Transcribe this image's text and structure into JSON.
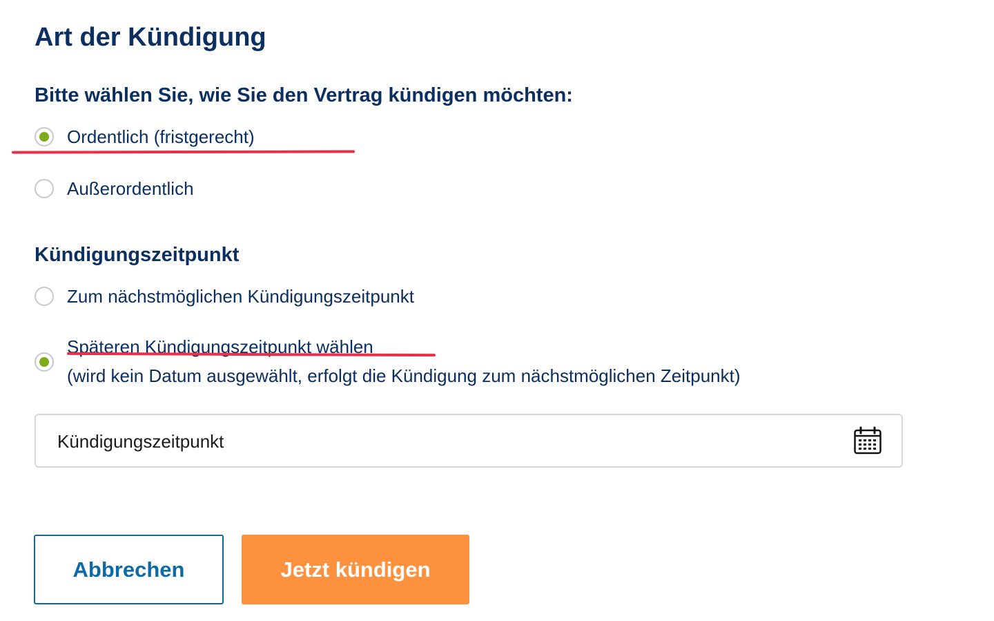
{
  "page": {
    "title": "Art der Kündigung"
  },
  "cancellation_type": {
    "question": "Bitte wählen Sie, wie Sie den Vertrag kündigen möchten:",
    "options": [
      {
        "label": "Ordentlich (fristgerecht)",
        "selected": true
      },
      {
        "label": "Außerordentlich",
        "selected": false
      }
    ]
  },
  "cancellation_date": {
    "heading": "Kündigungszeitpunkt",
    "options": [
      {
        "label": "Zum nächstmöglichen Kündigungszeitpunkt",
        "selected": false
      },
      {
        "label": "Späteren Kündigungszeitpunkt wählen",
        "hint": "(wird kein Datum ausgewählt, erfolgt die Kündigung zum nächstmöglichen Zeitpunkt)",
        "selected": true
      }
    ],
    "date_field": {
      "placeholder": "Kündigungszeitpunkt",
      "icon": "calendar-icon"
    }
  },
  "actions": {
    "cancel_label": "Abbrechen",
    "submit_label": "Jetzt kündigen"
  },
  "colors": {
    "heading": "#0b2f61",
    "radio_selected": "#7fab1a",
    "annotation_underline": "#e8304a",
    "cancel_button": "#0b6aa8",
    "submit_button": "#fd913d"
  }
}
